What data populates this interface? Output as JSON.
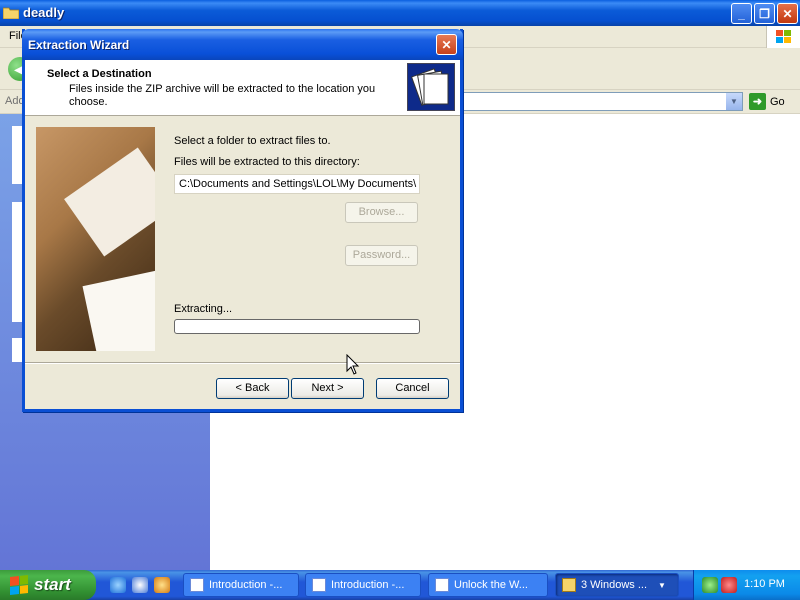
{
  "explorer": {
    "title": "deadly",
    "menu_first": "File",
    "address_label": "Address",
    "go_label": "Go",
    "caption_buttons": {
      "minimize": "_",
      "maximize": "❐",
      "close": "✕"
    }
  },
  "wizard": {
    "title": "Extraction Wizard",
    "close_glyph": "✕",
    "header_title": "Select a Destination",
    "header_subtitle": "Files inside the ZIP archive will be extracted to the location you choose.",
    "select_folder_text": "Select a folder to extract files to.",
    "directory_label": "Files will be extracted to this directory:",
    "path_value": "C:\\Documents and Settings\\LOL\\My Documents\\",
    "browse_label": "Browse...",
    "password_label": "Password...",
    "extracting_label": "Extracting...",
    "progress_fraction": 0,
    "back_label": "< Back",
    "next_label": "Next >",
    "cancel_label": "Cancel"
  },
  "taskbar": {
    "start_label": "start",
    "tasks": [
      {
        "label": "Introduction -...",
        "icon": "document-icon"
      },
      {
        "label": "Introduction -...",
        "icon": "document-icon"
      },
      {
        "label": "Unlock the W...",
        "icon": "document-icon"
      },
      {
        "label": "3 Windows ...",
        "icon": "folder-icon"
      }
    ],
    "clock": "1:10 PM"
  },
  "colors": {
    "xp_blue": "#0a4fd4",
    "taskpane_blue": "#6d8ddd",
    "start_green": "#3c9b3c",
    "dialog_face": "#ece9d8"
  }
}
